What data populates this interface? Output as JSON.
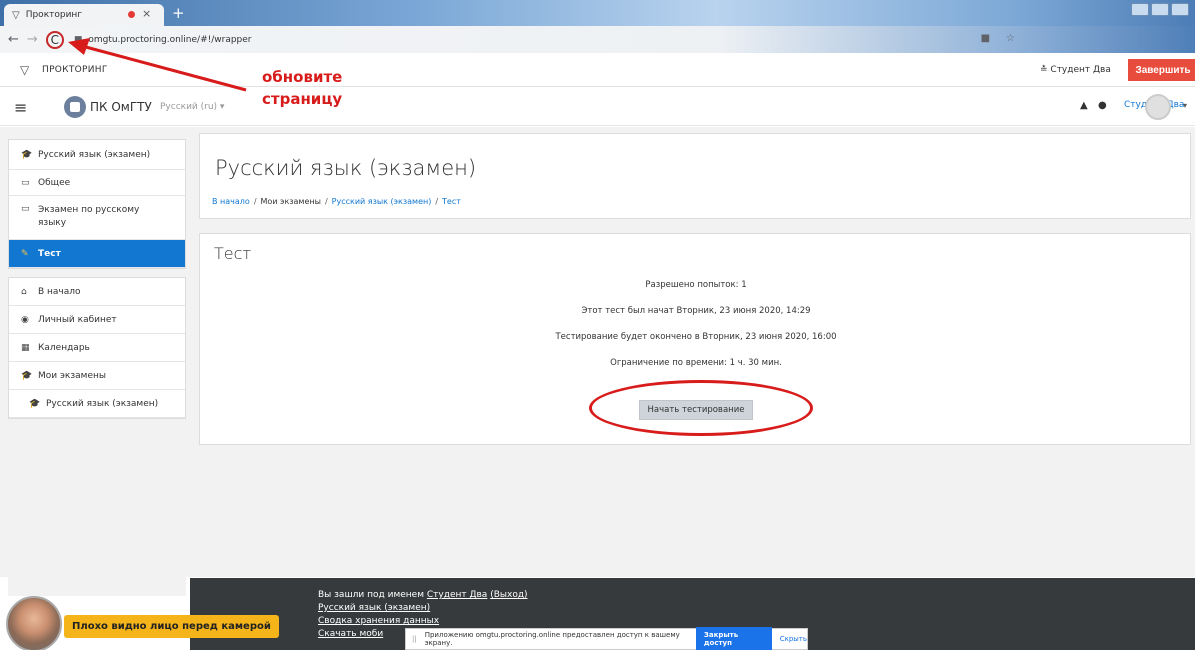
{
  "browser": {
    "tab_title": "Прокторинг",
    "tab_close": "×",
    "new_tab": "+",
    "url": "omgtu.proctoring.online/#!/wrapper",
    "nav_back": "←",
    "nav_forward": "→",
    "reload": "C",
    "lock": "🔒"
  },
  "proctoring": {
    "title": "ПРОКТОРИНГ",
    "user": "Студент Два",
    "finish_label": "Завершить"
  },
  "annotation": {
    "line1": "обновите",
    "line2": "страницу"
  },
  "navbar": {
    "menu_icon": "≡",
    "site_name": "ПК ОмГТУ",
    "language": "Русский (ru) ▾",
    "bell": "🔔",
    "chat": "💬",
    "user_name": "Студент Два",
    "caret": "▾"
  },
  "drawer": {
    "items_top": [
      {
        "icon": "🎓",
        "label": "Русский язык (экзамен)"
      },
      {
        "icon": "▭",
        "label": "Общее"
      },
      {
        "icon": "▭",
        "label": "Экзамен по русскому языку"
      },
      {
        "icon": "✎",
        "label": "Тест",
        "active": true
      }
    ],
    "items_bottom": [
      {
        "icon": "⌂",
        "label": "В начало"
      },
      {
        "icon": "◉",
        "label": "Личный кабинет"
      },
      {
        "icon": "▦",
        "label": "Календарь"
      },
      {
        "icon": "🎓",
        "label": "Мои экзамены"
      },
      {
        "icon": "🎓",
        "label": "Русский язык (экзамен)"
      }
    ]
  },
  "header": {
    "course_title": "Русский язык (экзамен)",
    "breadcrumb": [
      "В начало",
      "Мои экзамены",
      "Русский язык (экзамен)",
      "Тест"
    ],
    "breadcrumb_sep": "/"
  },
  "quiz": {
    "title": "Тест",
    "attempts": "Разрешено попыток: 1",
    "started": "Этот тест был начат Вторник, 23 июня 2020, 14:29",
    "ends": "Тестирование будет окончено в Вторник, 23 июня 2020, 16:00",
    "time_limit": "Ограничение по времени: 1 ч. 30 мин.",
    "start_label": "Начать тестирование"
  },
  "footer": {
    "logged_in_prefix": "Вы зашли под именем ",
    "user": "Студент Два",
    "logout": "(Выход)",
    "course_link": "Русский язык (экзамен)",
    "data_link": "Сводка хранения данных",
    "mobile_link": "Скачать моби"
  },
  "share_bar": {
    "text": "Приложению omgtu.proctoring.online предоставлен доступ к вашему экрану.",
    "stop_label": "Закрыть доступ",
    "hide_label": "Скрыть"
  },
  "camera": {
    "warning": "Плохо видно лицо перед камерой"
  }
}
